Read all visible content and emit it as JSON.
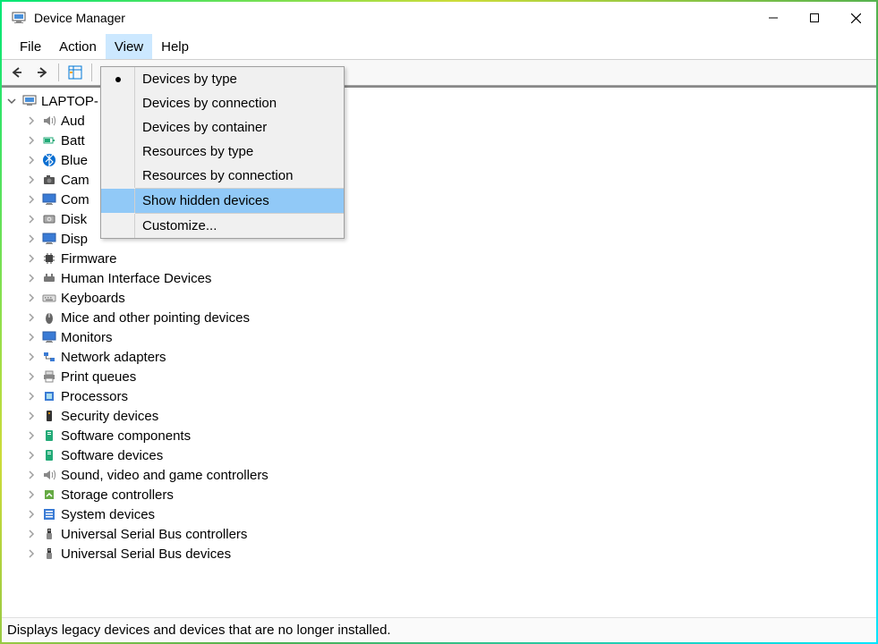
{
  "window": {
    "title": "Device Manager"
  },
  "menu": {
    "file": "File",
    "action": "Action",
    "view": "View",
    "help": "Help"
  },
  "viewMenu": {
    "devicesByType": "Devices by type",
    "devicesByConnection": "Devices by connection",
    "devicesByContainer": "Devices by container",
    "resourcesByType": "Resources by type",
    "resourcesByConnection": "Resources by connection",
    "showHidden": "Show hidden devices",
    "customize": "Customize..."
  },
  "tree": {
    "root": "LAPTOP-",
    "nodes": [
      {
        "label": "Aud",
        "icon": "speaker"
      },
      {
        "label": "Batt",
        "icon": "battery"
      },
      {
        "label": "Blue",
        "icon": "bluetooth"
      },
      {
        "label": "Cam",
        "icon": "camera"
      },
      {
        "label": "Com",
        "icon": "monitor"
      },
      {
        "label": "Disk",
        "icon": "disk"
      },
      {
        "label": "Disp",
        "icon": "monitor"
      },
      {
        "label": "Firmware",
        "icon": "chip"
      },
      {
        "label": "Human Interface Devices",
        "icon": "hid"
      },
      {
        "label": "Keyboards",
        "icon": "keyboard"
      },
      {
        "label": "Mice and other pointing devices",
        "icon": "mouse"
      },
      {
        "label": "Monitors",
        "icon": "monitor"
      },
      {
        "label": "Network adapters",
        "icon": "network"
      },
      {
        "label": "Print queues",
        "icon": "printer"
      },
      {
        "label": "Processors",
        "icon": "cpu"
      },
      {
        "label": "Security devices",
        "icon": "security"
      },
      {
        "label": "Software components",
        "icon": "software"
      },
      {
        "label": "Software devices",
        "icon": "software"
      },
      {
        "label": "Sound, video and game controllers",
        "icon": "speaker"
      },
      {
        "label": "Storage controllers",
        "icon": "storage"
      },
      {
        "label": "System devices",
        "icon": "system"
      },
      {
        "label": "Universal Serial Bus controllers",
        "icon": "usb"
      },
      {
        "label": "Universal Serial Bus devices",
        "icon": "usb"
      }
    ]
  },
  "statusbar": "Displays legacy devices and devices that are no longer installed."
}
